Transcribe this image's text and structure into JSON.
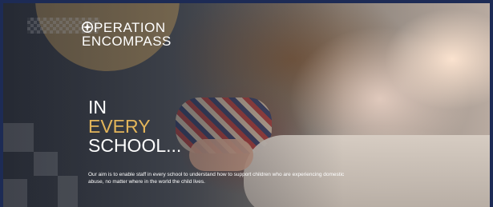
{
  "logo": {
    "line1": "PERATION",
    "line2": "ENCOMPASS"
  },
  "headline": {
    "line1": "IN",
    "line2": "EVERY",
    "line3": "SCHOOL..."
  },
  "description": "Our aim is to enable staff in every school to understand how to support children who are experiencing domestic abuse, no matter where in the world the child lives.",
  "colors": {
    "frame": "#1d2b55",
    "accent": "#e3b55a",
    "text": "#ffffff"
  },
  "icons": {
    "logo_mark": "compass-icon"
  }
}
